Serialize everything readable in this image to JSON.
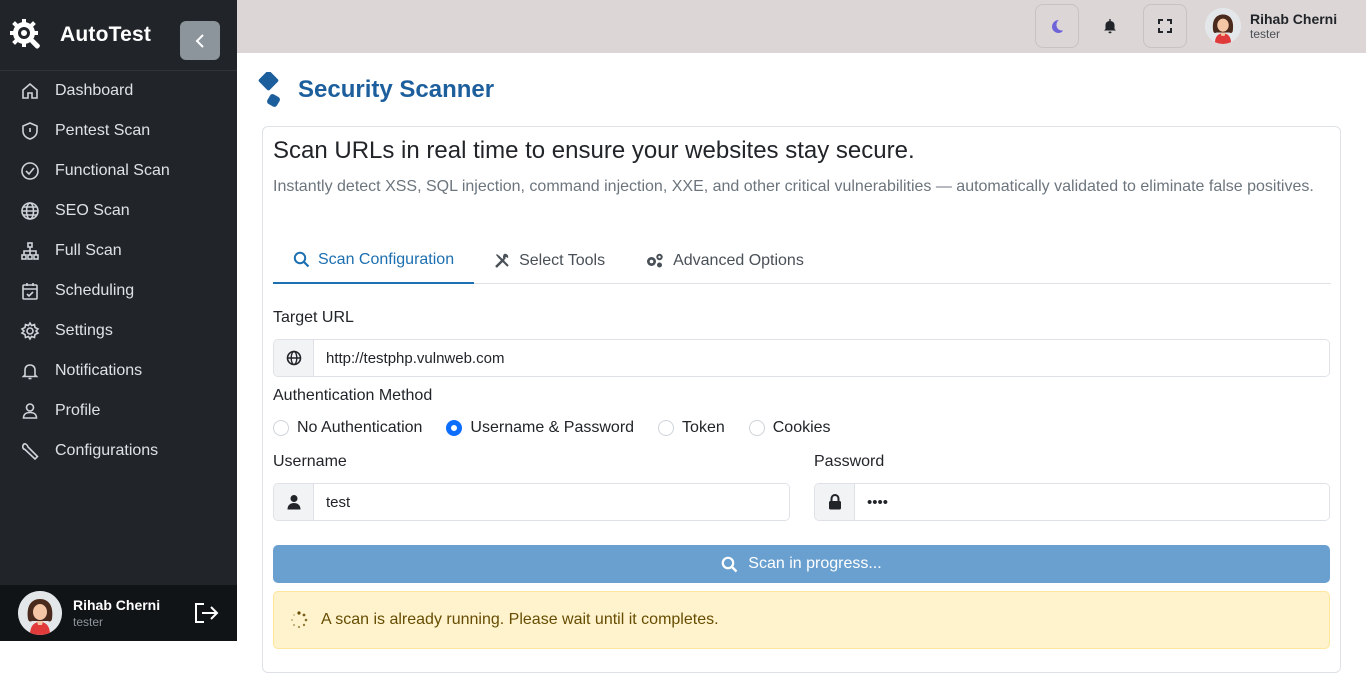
{
  "sidebar": {
    "brand": "AutoTest",
    "items": [
      {
        "label": "Dashboard",
        "icon": "home-icon"
      },
      {
        "label": "Pentest Scan",
        "icon": "shield-icon"
      },
      {
        "label": "Functional Scan",
        "icon": "check-circle-icon"
      },
      {
        "label": "SEO Scan",
        "icon": "globe-icon"
      },
      {
        "label": "Full Scan",
        "icon": "sitemap-icon"
      },
      {
        "label": "Scheduling",
        "icon": "calendar-check-icon"
      },
      {
        "label": "Settings",
        "icon": "gear-icon"
      },
      {
        "label": "Notifications",
        "icon": "bell-icon"
      },
      {
        "label": "Profile",
        "icon": "user-icon"
      },
      {
        "label": "Configurations",
        "icon": "wrench-icon"
      }
    ],
    "user": {
      "name": "Rihab Cherni",
      "role": "tester"
    }
  },
  "topbar": {
    "user": {
      "name": "Rihab Cherni",
      "role": "tester"
    }
  },
  "page": {
    "title": "Security Scanner",
    "headline": "Scan URLs in real time to ensure your websites stay secure.",
    "subline": "Instantly detect XSS, SQL injection, command injection, XXE, and other critical vulnerabilities — automatically validated to eliminate false positives."
  },
  "tabs": [
    {
      "label": "Scan Configuration",
      "active": true
    },
    {
      "label": "Select Tools",
      "active": false
    },
    {
      "label": "Advanced Options",
      "active": false
    }
  ],
  "form": {
    "target_url_label": "Target URL",
    "target_url_value": "http://testphp.vulnweb.com",
    "auth_label": "Authentication Method",
    "auth_options": [
      {
        "label": "No Authentication",
        "checked": false
      },
      {
        "label": "Username & Password",
        "checked": true
      },
      {
        "label": "Token",
        "checked": false
      },
      {
        "label": "Cookies",
        "checked": false
      }
    ],
    "username_label": "Username",
    "username_value": "test",
    "password_label": "Password",
    "password_value": "test"
  },
  "scan_button": "Scan in progress...",
  "alert": "A scan is already running. Please wait until it completes.",
  "colors": {
    "sidebar_bg": "#212529",
    "topbar_bg": "#dcd6d6",
    "accent": "#1c6fb0",
    "title": "#1c5f9c",
    "button_disabled": "#6aa0cf",
    "alert_bg": "#fff3cd"
  }
}
